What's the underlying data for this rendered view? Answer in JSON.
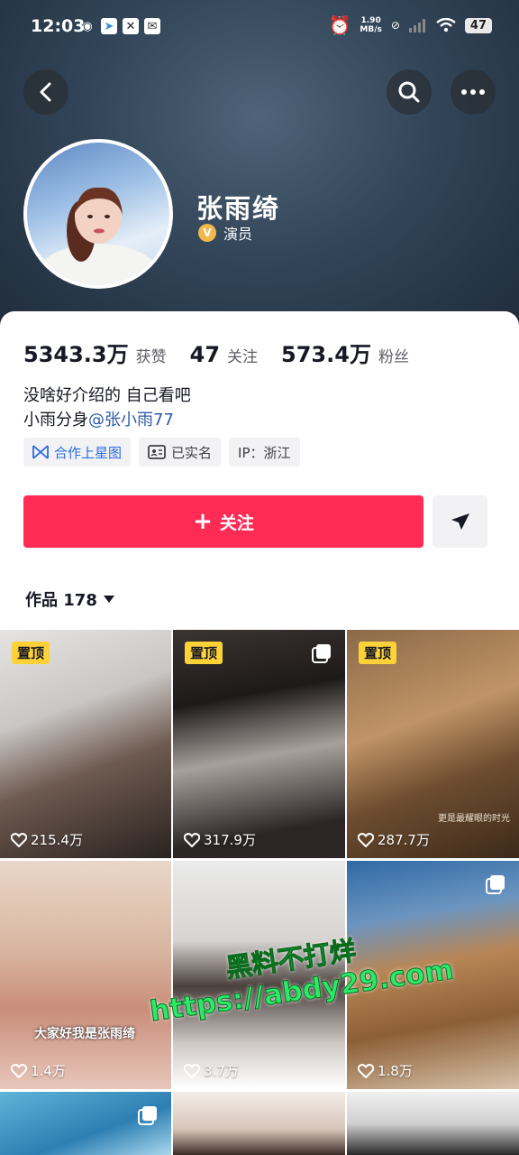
{
  "status_bar": {
    "time": "12:03",
    "net_speed_value": "1.90",
    "net_speed_unit": "MB/s",
    "battery": "47"
  },
  "profile": {
    "name": "张雨绮",
    "verification": "演员",
    "verification_badge": "V"
  },
  "stats": [
    {
      "value": "5343.3万",
      "label": "获赞"
    },
    {
      "value": "47",
      "label": "关注"
    },
    {
      "value": "573.4万",
      "label": "粉丝"
    }
  ],
  "bio": {
    "line1": "没啥好介绍的 自己看吧",
    "line2_prefix": "小雨分身",
    "line2_mention": "@张小雨77"
  },
  "tags": [
    {
      "label": "合作上星图",
      "icon": "xingtu-icon"
    },
    {
      "label": "已实名",
      "icon": "id-card-icon"
    },
    {
      "label": "IP：浙江",
      "icon": ""
    }
  ],
  "actions": {
    "follow_label": "关注",
    "follow_plus": "+"
  },
  "works": {
    "label": "作品 178"
  },
  "videos": [
    {
      "pinned": "置顶",
      "likes": "215.4万",
      "bg": "linear-gradient(160deg,#e6e4e2 0%,#c9c6c4 35%,#6e5a50 60%,#2a2320 100%)"
    },
    {
      "pinned": "置顶",
      "likes": "317.9万",
      "bg": "linear-gradient(170deg,#3a3432 0%,#1e1a19 30%,#a7a19c 55%,#2b2625 85%)",
      "multi": true
    },
    {
      "pinned": "置顶",
      "likes": "287.7万",
      "bg": "linear-gradient(160deg,#8a6a48 0%,#c19467 40%,#6e4d30 65%,#3d2a1a 100%)",
      "subcaption": "更是最耀眼的时光"
    },
    {
      "pinned": "",
      "likes": "1.4万",
      "bg": "linear-gradient(180deg,#e9d6c8 0%,#d8b59f 40%,#c98d7a 65%,#e8c7bb 100%)",
      "caption": "大家好我是张雨绮"
    },
    {
      "pinned": "",
      "likes": "3.7万",
      "bg": "linear-gradient(180deg,#ebebeb 0%,#d7d3d0 35%,#4a403c 55%,#cfc9c6 80%,#ffffff 100%)"
    },
    {
      "pinned": "",
      "likes": "1.8万",
      "bg": "linear-gradient(170deg,#2f6aa4 0%,#6b94c0 25%,#b88656 45%,#8d5f37 70%,#d7c2a9 100%)",
      "multi": true
    },
    {
      "pinned": "",
      "likes": "",
      "bg": "linear-gradient(160deg,#5fb4d8 0%,#2d7fb3 60%,#a9d7ec 100%)",
      "multi": true
    },
    {
      "pinned": "",
      "likes": "",
      "bg": "linear-gradient(180deg,#f3ede8 0%,#d6c4b8 60%,#3b2c26 100%)"
    },
    {
      "pinned": "",
      "likes": "",
      "bg": "linear-gradient(180deg,#f0f0f0 0%,#d0d0d0 50%,#2a2a2a 100%)"
    }
  ],
  "watermark": {
    "line1": "黑料不打烊",
    "line2": "https://abdy29.com"
  },
  "colors": {
    "accent": "#fe2c55",
    "pin_badge": "#fdd239",
    "mention": "#2e5aa7"
  }
}
